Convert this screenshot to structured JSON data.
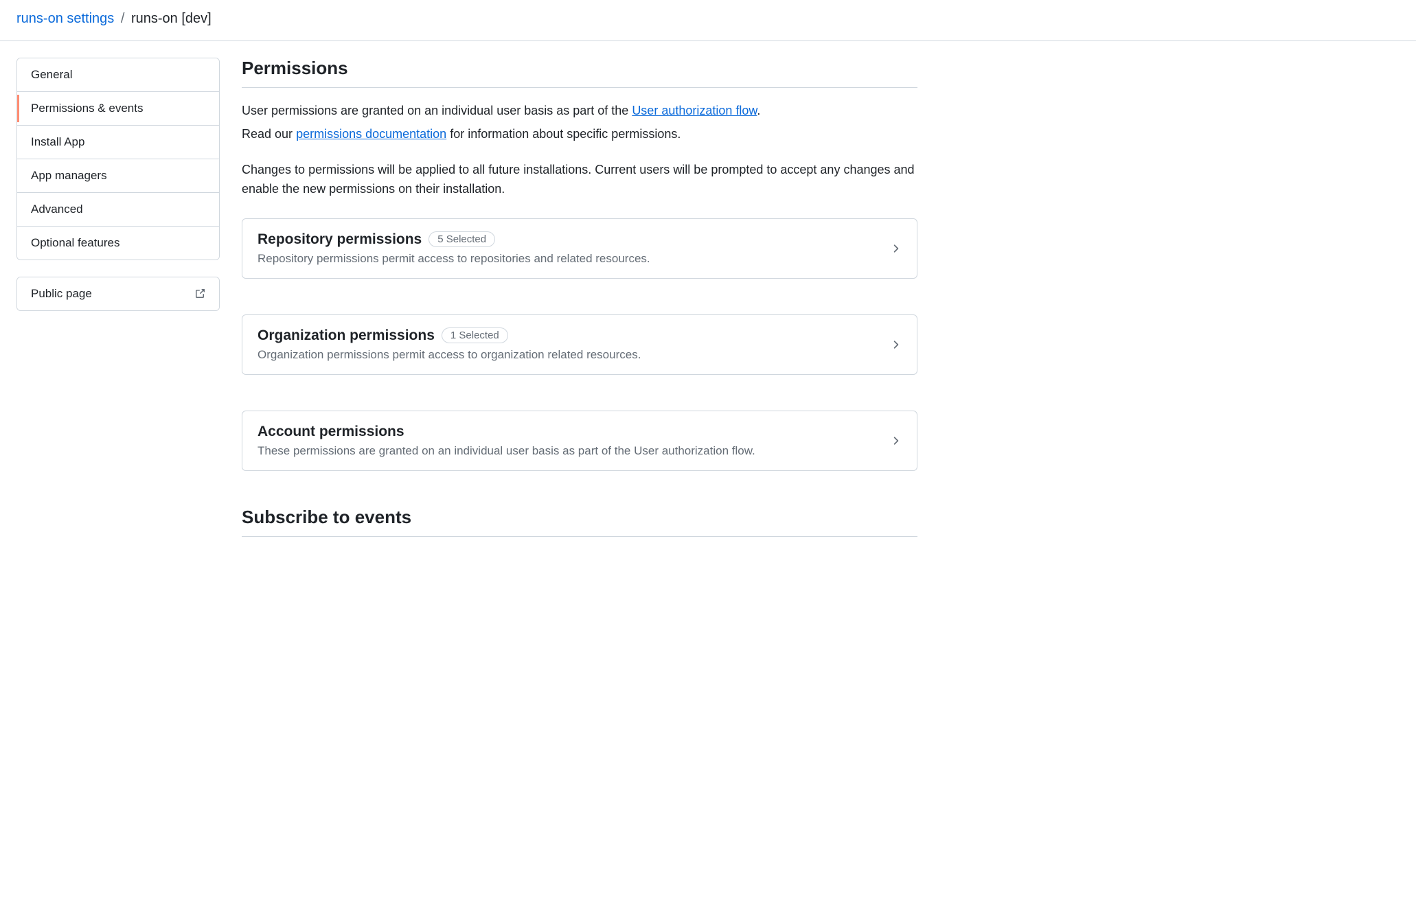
{
  "breadcrumb": {
    "parent": "runs-on settings",
    "current": "runs-on [dev]"
  },
  "sidebar": {
    "items": [
      {
        "label": "General"
      },
      {
        "label": "Permissions & events"
      },
      {
        "label": "Install App"
      },
      {
        "label": "App managers"
      },
      {
        "label": "Advanced"
      },
      {
        "label": "Optional features"
      }
    ],
    "public_page": "Public page"
  },
  "main": {
    "title": "Permissions",
    "intro": {
      "p1_before": "User permissions are granted on an individual user basis as part of the ",
      "p1_link": "User authorization flow",
      "p1_after": ".",
      "p2_before": "Read our ",
      "p2_link": "permissions documentation",
      "p2_after": " for information about specific permissions.",
      "p3": "Changes to permissions will be applied to all future installations. Current users will be prompted to accept any changes and enable the new permissions on their installation."
    },
    "cards": [
      {
        "title": "Repository permissions",
        "badge": "5 Selected",
        "desc": "Repository permissions permit access to repositories and related resources."
      },
      {
        "title": "Organization permissions",
        "badge": "1 Selected",
        "desc": "Organization permissions permit access to organization related resources."
      },
      {
        "title": "Account permissions",
        "badge": "",
        "desc": "These permissions are granted on an individual user basis as part of the User authorization flow."
      }
    ],
    "events_title": "Subscribe to events"
  }
}
